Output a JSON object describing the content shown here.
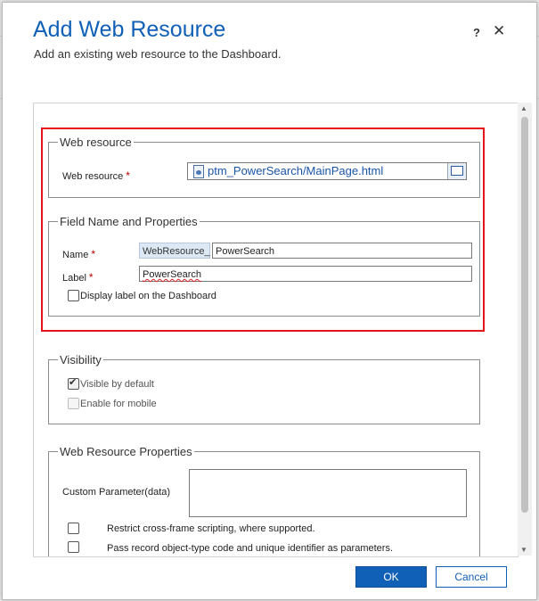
{
  "dialog": {
    "title": "Add Web Resource",
    "subtitle": "Add an existing web resource to the Dashboard.",
    "help_icon": "?",
    "close_icon": "✕"
  },
  "web_resource_group": {
    "legend": "Web resource",
    "web_resource_label": "Web resource",
    "required_mark": "*",
    "web_resource_value": "ptm_PowerSearch/MainPage.html",
    "lookup_icon": "lookup-icon"
  },
  "field_group": {
    "legend": "Field Name and Properties",
    "name_label": "Name",
    "name_prefix": "WebResource_",
    "name_value": "PowerSearch",
    "label_label": "Label",
    "label_value": "PowerSearch",
    "display_label_text": "Display label on the Dashboard",
    "display_label_checked": false
  },
  "visibility_group": {
    "legend": "Visibility",
    "visible_default_text": "Visible by default",
    "visible_default_checked": true,
    "enable_mobile_text": "Enable for mobile",
    "enable_mobile_checked": false
  },
  "properties_group": {
    "legend": "Web Resource Properties",
    "custom_param_label": "Custom Parameter(data)",
    "custom_param_value": "",
    "restrict_text": "Restrict cross-frame scripting, where supported.",
    "pass_record_text": "Pass record object-type code and unique identifier as parameters."
  },
  "footer": {
    "ok_label": "OK",
    "cancel_label": "Cancel"
  },
  "colors": {
    "title_blue": "#1160b7",
    "highlight_red": "#e3151a",
    "ok_button_bg": "#1160b7"
  }
}
